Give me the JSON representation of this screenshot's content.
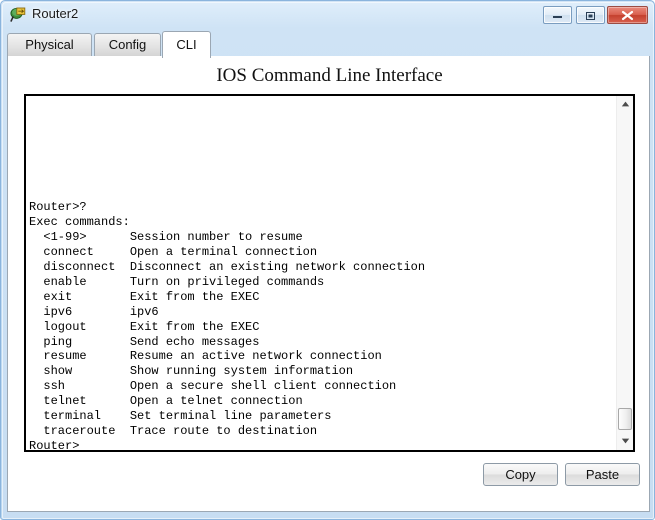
{
  "window": {
    "title": "Router2",
    "icon": "router-icon",
    "controls": {
      "minimize_label": "Minimize",
      "maximize_label": "Maximize",
      "close_label": "Close"
    }
  },
  "tabs": [
    {
      "label": "Physical",
      "active": false
    },
    {
      "label": "Config",
      "active": false
    },
    {
      "label": "CLI",
      "active": true
    }
  ],
  "panel": {
    "heading": "IOS Command Line Interface"
  },
  "terminal": {
    "content": "\n\n\n\n\n\n\nRouter>?\nExec commands:\n  <1-99>      Session number to resume\n  connect     Open a terminal connection\n  disconnect  Disconnect an existing network connection\n  enable      Turn on privileged commands\n  exit        Exit from the EXEC\n  ipv6        ipv6\n  logout      Exit from the EXEC\n  ping        Send echo messages\n  resume      Resume an active network connection\n  show        Show running system information\n  ssh         Open a secure shell client connection\n  telnet      Open a telnet connection\n  terminal    Set terminal line parameters\n  traceroute  Trace route to destination\nRouter>",
    "prompt": "Router>",
    "command_entered": "?",
    "header_line": "Exec commands:",
    "commands": [
      {
        "name": "<1-99>",
        "description": "Session number to resume"
      },
      {
        "name": "connect",
        "description": "Open a terminal connection"
      },
      {
        "name": "disconnect",
        "description": "Disconnect an existing network connection"
      },
      {
        "name": "enable",
        "description": "Turn on privileged commands"
      },
      {
        "name": "exit",
        "description": "Exit from the EXEC"
      },
      {
        "name": "ipv6",
        "description": "ipv6"
      },
      {
        "name": "logout",
        "description": "Exit from the EXEC"
      },
      {
        "name": "ping",
        "description": "Send echo messages"
      },
      {
        "name": "resume",
        "description": "Resume an active network connection"
      },
      {
        "name": "show",
        "description": "Show running system information"
      },
      {
        "name": "ssh",
        "description": "Open a secure shell client connection"
      },
      {
        "name": "telnet",
        "description": "Open a telnet connection"
      },
      {
        "name": "terminal",
        "description": "Set terminal line parameters"
      },
      {
        "name": "traceroute",
        "description": "Trace route to destination"
      }
    ],
    "scrollbar": {
      "up_arrow": "scroll-up-icon",
      "down_arrow": "scroll-down-icon",
      "thumb_position": "bottom"
    }
  },
  "footer": {
    "copy_label": "Copy",
    "paste_label": "Paste"
  },
  "colors": {
    "frame": "#c3dcf2",
    "frame_border": "#8ab4dd",
    "tab_active_bg": "#ffffff",
    "tab_inactive_bg": "#e3e3e3",
    "terminal_bg": "#ffffff",
    "terminal_fg": "#000000",
    "close_button": "#c4402e"
  }
}
